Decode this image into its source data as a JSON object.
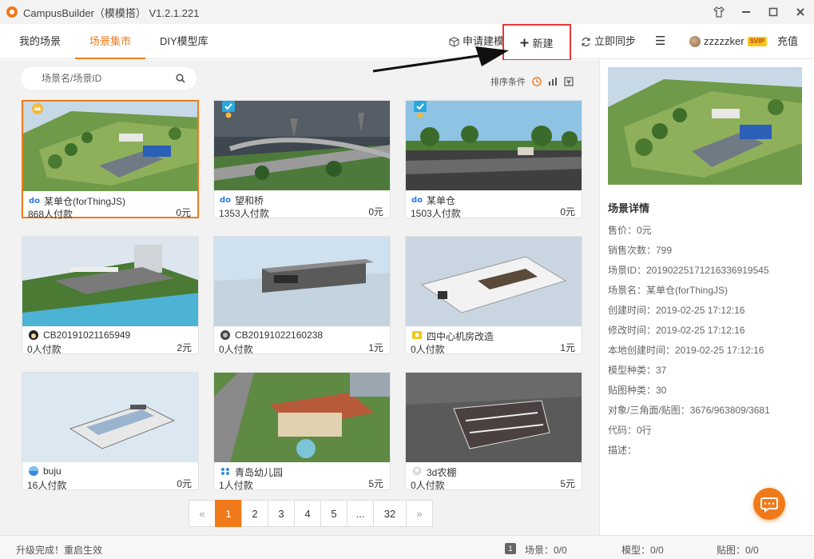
{
  "app": {
    "title": "CampusBuilder（模模搭） V1.2.1.221"
  },
  "nav": {
    "tabs": [
      "我的场景",
      "场景集市",
      "DIY模型库"
    ],
    "apply_model": "申请建模",
    "new_label": "新建",
    "sync_label": "立即同步",
    "menu_icon": "☰",
    "username": "zzzzzker",
    "vip_label": "SVIP",
    "recharge": "充值"
  },
  "search": {
    "placeholder": "场景名/场景ID"
  },
  "sort": {
    "label": "排序条件"
  },
  "cards": [
    {
      "name": "某单仓(forThingJS)",
      "buyers": "868人付款",
      "price": "0元"
    },
    {
      "name": "望和桥",
      "buyers": "1353人付款",
      "price": "0元"
    },
    {
      "name": "某单仓",
      "buyers": "1503人付款",
      "price": "0元"
    },
    {
      "name": "CB20191021165949",
      "buyers": "0人付款",
      "price": "2元"
    },
    {
      "name": "CB20191022160238",
      "buyers": "0人付款",
      "price": "1元"
    },
    {
      "name": "四中心机房改造",
      "buyers": "0人付款",
      "price": "1元"
    },
    {
      "name": "buju",
      "buyers": "16人付款",
      "price": "0元"
    },
    {
      "name": "青岛幼儿园",
      "buyers": "1人付款",
      "price": "5元"
    },
    {
      "name": "3d农棚",
      "buyers": "0人付款",
      "price": "5元"
    }
  ],
  "pagination": {
    "prev": "«",
    "pages": [
      "1",
      "2",
      "3",
      "4",
      "5",
      "...",
      "32"
    ],
    "next": "»",
    "current": "1"
  },
  "detail": {
    "title": "场景详情",
    "rows": [
      "售价：0元",
      "销售次数：799",
      "场景ID：20190225171216336919545",
      "场景名：某单仓(forThingJS)",
      "创建时间：2019-02-25 17:12:16",
      "修改时间：2019-02-25 17:12:16",
      "本地创建时间：2019-02-25 17:12:16",
      "模型种类：37",
      "贴图种类：30",
      "对象/三角面/贴图：3676/963809/3681",
      "代码：0行",
      "描述："
    ]
  },
  "status": {
    "message": "升级完成！重启生效",
    "badge_num": "1",
    "scene": "场景：0/0",
    "model": "模型：0/0",
    "texture": "贴图：0/0"
  },
  "colors": {
    "accent": "#f07a1a",
    "highlight_box": "#e03a3a"
  }
}
